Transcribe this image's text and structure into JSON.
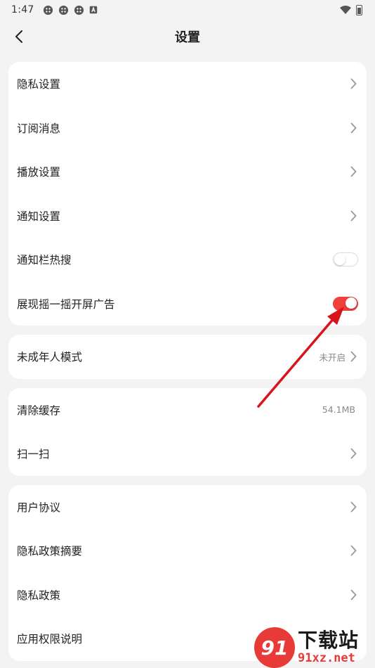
{
  "status_bar": {
    "time": "1:47"
  },
  "header": {
    "title": "设置"
  },
  "group1": [
    {
      "label": "隐私设置",
      "type": "link"
    },
    {
      "label": "订阅消息",
      "type": "link"
    },
    {
      "label": "播放设置",
      "type": "link"
    },
    {
      "label": "通知设置",
      "type": "link"
    },
    {
      "label": "通知栏热搜",
      "type": "toggle",
      "on": false
    },
    {
      "label": "展现摇一摇开屏广告",
      "type": "toggle",
      "on": true
    }
  ],
  "group2": [
    {
      "label": "未成年人模式",
      "value": "未开启",
      "type": "link"
    }
  ],
  "group3": [
    {
      "label": "清除缓存",
      "value": "54.1MB",
      "type": "value"
    },
    {
      "label": "扫一扫",
      "type": "link"
    }
  ],
  "group4": [
    {
      "label": "用户协议",
      "type": "link"
    },
    {
      "label": "隐私政策摘要",
      "type": "link"
    },
    {
      "label": "隐私政策",
      "type": "link"
    },
    {
      "label": "应用权限说明",
      "type": "link"
    }
  ],
  "watermark": {
    "logo": "91",
    "text": "下载站",
    "domain": "91xz.net"
  },
  "colors": {
    "accent": "#f0403c",
    "arrow": "#d8141c",
    "background": "#f3f3f3"
  }
}
